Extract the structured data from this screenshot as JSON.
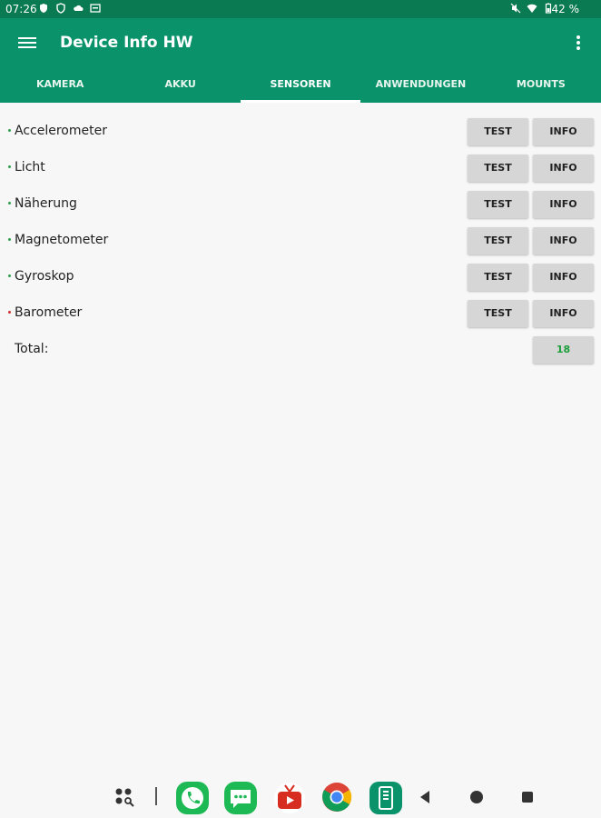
{
  "status_bar": {
    "time": "07:26",
    "battery_percent": "42 %"
  },
  "app_bar": {
    "title": "Device Info HW"
  },
  "tabs": [
    {
      "label": "KAMERA"
    },
    {
      "label": "AKKU"
    },
    {
      "label": "SENSOREN",
      "active": true
    },
    {
      "label": "ANWENDUNGEN"
    },
    {
      "label": "MOUNTS"
    }
  ],
  "sensors": [
    {
      "name": "Accelerometer",
      "status_color": "#2e9e4a",
      "test_label": "TEST",
      "info_label": "INFO"
    },
    {
      "name": "Licht",
      "status_color": "#2e9e4a",
      "test_label": "TEST",
      "info_label": "INFO"
    },
    {
      "name": "Näherung",
      "status_color": "#2e9e4a",
      "test_label": "TEST",
      "info_label": "INFO"
    },
    {
      "name": "Magnetometer",
      "status_color": "#2e9e4a",
      "test_label": "TEST",
      "info_label": "INFO"
    },
    {
      "name": "Gyroskop",
      "status_color": "#2e9e4a",
      "test_label": "TEST",
      "info_label": "INFO"
    },
    {
      "name": "Barometer",
      "status_color": "#d32f2f",
      "test_label": "TEST",
      "info_label": "INFO"
    }
  ],
  "total": {
    "label": "Total:",
    "value": "18"
  },
  "taskbar": {
    "apps": [
      "app-drawer-icon",
      "phone-icon",
      "messages-icon",
      "tv-app-icon",
      "chrome-icon",
      "device-info-icon"
    ],
    "nav": [
      "back-icon",
      "home-icon",
      "recents-icon"
    ]
  },
  "colors": {
    "status_bar": "#0a7a52",
    "app_bar": "#0a936a",
    "ok": "#2e9e4a",
    "error": "#d32f2f"
  }
}
